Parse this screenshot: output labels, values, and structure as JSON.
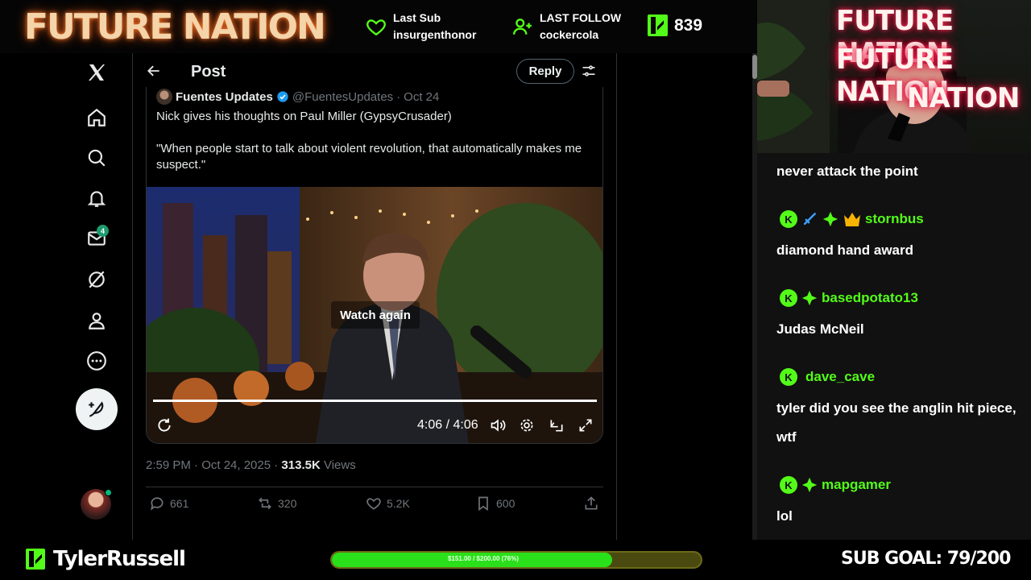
{
  "overlay": {
    "brand": "FUTURE NATION",
    "last_sub": {
      "label": "Last Sub",
      "value": "insurgenthonor"
    },
    "last_follow": {
      "label": "LAST FOLLOW",
      "value": "cockercola"
    },
    "kick_count": "839",
    "webcam_sign": [
      "FUTURE NATION",
      "FUTURE NATION",
      "NATION"
    ],
    "channel_name": "TylerRussell",
    "goal_bar": {
      "text": "$151.00 / $200.00 (76%)",
      "progress": 0.76
    },
    "sub_goal": "SUB GOAL: 79/200"
  },
  "x_nav": {
    "icons": [
      "x-logo-icon",
      "home-icon",
      "search-icon",
      "notifications-icon",
      "messages-icon",
      "grok-icon",
      "profile-icon",
      "more-icon",
      "compose-icon"
    ],
    "messages_badge": "4"
  },
  "post": {
    "header_title": "Post",
    "reply_label": "Reply",
    "quote": {
      "name": "Fuentes Updates",
      "handle": "@FuentesUpdates",
      "dot": "·",
      "date": "Oct 24",
      "line1": "Nick gives his thoughts on Paul Miller (GypsyCrusader)",
      "line2": "\"When people start to talk about violent revolution, that automatically makes me suspect.\""
    },
    "video": {
      "overlay_label": "Watch again",
      "time": "4:06 / 4:06",
      "progress": 1.0
    },
    "meta": {
      "time": "2:59 PM · Oct 24, 2025 · ",
      "views_count": "313.5K",
      "views_label": " Views"
    },
    "actions": {
      "replies": "661",
      "reposts": "320",
      "likes": "5.2K",
      "bookmarks": "600"
    }
  },
  "chat": {
    "messages": [
      {
        "user": "",
        "text": "never attack the point"
      },
      {
        "user": "stornbus",
        "text": "diamond hand award"
      },
      {
        "user": "basedpotato13",
        "text": "Judas McNeil"
      },
      {
        "user": "dave_cave",
        "text": "tyler did you see the anglin hit piece, wtf"
      },
      {
        "user": "mapgamer",
        "text": "lol"
      }
    ]
  },
  "colors": {
    "kick_green": "#53fc18",
    "x_bg": "#000000",
    "x_border": "#2f3336",
    "muted": "#71767b",
    "verified_blue": "#1d9bf0"
  }
}
